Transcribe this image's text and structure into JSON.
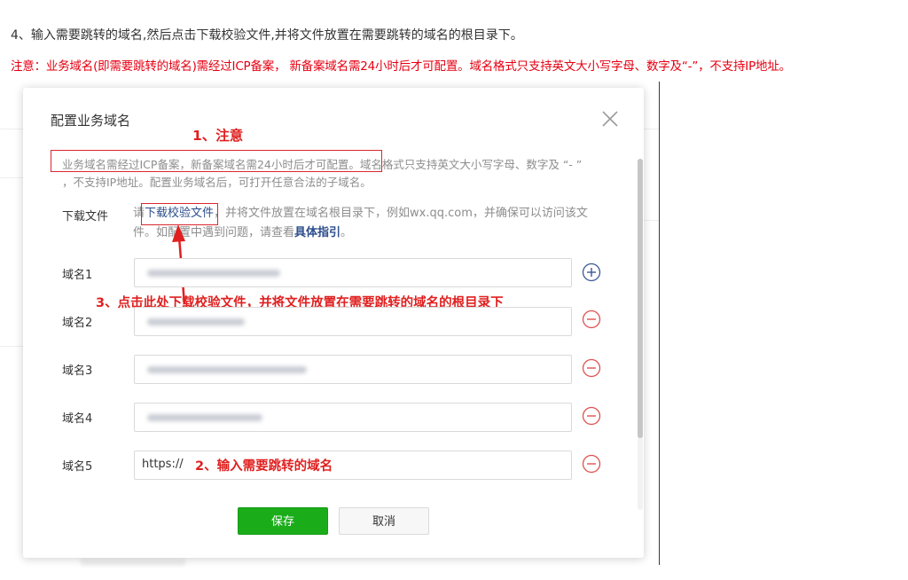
{
  "page": {
    "step_text": "4、输入需要跳转的域名,然后点击下载校验文件,并将文件放置在需要跳转的域名的根目录下。",
    "notice_text": "注意：业务域名(即需要跳转的域名)需经过ICP备案， 新备案域名需24小时后才可配置。域名格式只支持英文大小写字母、数字及“-”，不支持IP地址。"
  },
  "dialog": {
    "title": "配置业务域名",
    "close_icon": "close-icon",
    "description": "业务域名需经过ICP备案，新备案域名需24小时后才可配置。域名格式只支持英文大小写字母、数字及 “- ” ，不支持IP地址。配置业务域名后，可打开任意合法的子域名。",
    "download": {
      "label": "下载文件",
      "text_before": "请",
      "link": "下载校验文件",
      "text_after": "，并将文件放置在域名根目录下，例如wx.qq.com，并确保可以访问该文件。如配置中遇到问题，请查看",
      "guide_link": "具体指引",
      "end": "。"
    },
    "fields": [
      {
        "label": "域名1",
        "value": "",
        "icon": "plus-circle-icon"
      },
      {
        "label": "域名2",
        "value": "",
        "icon": "minus-circle-icon"
      },
      {
        "label": "域名3",
        "value": "",
        "icon": "minus-circle-icon"
      },
      {
        "label": "域名4",
        "value": "",
        "icon": "minus-circle-icon"
      },
      {
        "label": "域名5",
        "value": "https://",
        "icon": "minus-circle-icon"
      }
    ],
    "save_label": "保存",
    "cancel_label": "取消"
  },
  "annotations": {
    "note1": "1、注意",
    "note2": "2、输入需要跳转的域名",
    "note3": "3、点击此处下载校验文件，并将文件放置在需要跳转的域名的根目录下"
  },
  "colors": {
    "annotation_red": "#e02020",
    "notice_red": "#e60012",
    "save_green": "#1aad19",
    "link_blue": "#2c4e8c",
    "remove_red": "#e05050",
    "add_blue": "#3a5898"
  }
}
